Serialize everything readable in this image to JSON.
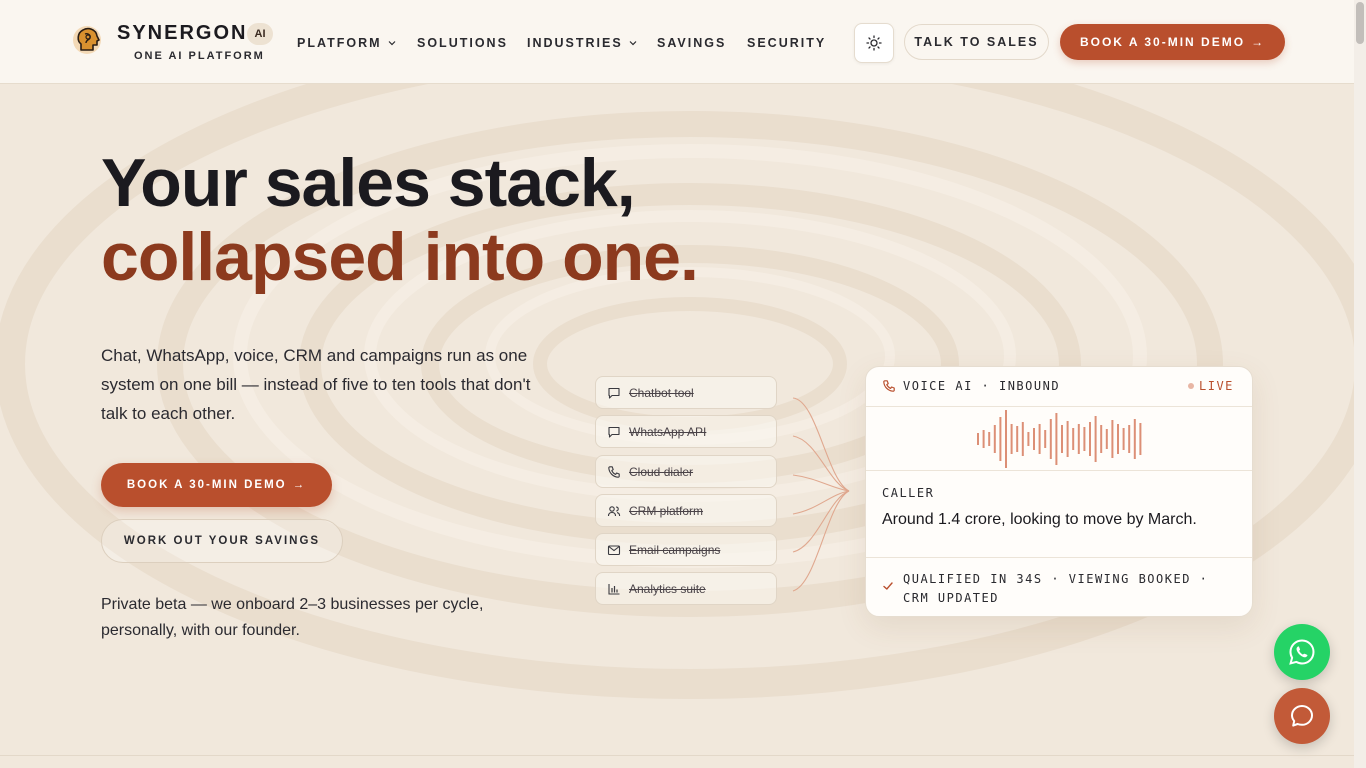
{
  "brand": {
    "name": "SYNERGON",
    "badge": "AI",
    "tagline": "ONE AI PLATFORM"
  },
  "nav": {
    "items": [
      {
        "label": "PLATFORM",
        "has_dropdown": true
      },
      {
        "label": "SOLUTIONS",
        "has_dropdown": false
      },
      {
        "label": "INDUSTRIES",
        "has_dropdown": true
      },
      {
        "label": "SAVINGS",
        "has_dropdown": false
      },
      {
        "label": "SECURITY",
        "has_dropdown": false
      }
    ],
    "theme_icon": "sun-icon",
    "talk_label": "TALK TO SALES",
    "demo_label": "BOOK A 30-MIN DEMO",
    "demo_arrow": "→"
  },
  "hero": {
    "headline": "Your sales stack,",
    "headline_accent": "collapsed into one.",
    "subheading": "Chat, WhatsApp, voice, CRM and campaigns run as one system on one bill — instead of five to ten tools that don't talk to each other.",
    "primary_cta": "BOOK A 30-MIN DEMO",
    "primary_cta_arrow": "→",
    "secondary_cta": "WORK OUT YOUR SAVINGS",
    "note": "Private beta — we onboard 2–3 businesses per cycle, personally, with our founder."
  },
  "tools": [
    {
      "label": "Chatbot tool",
      "icon": "chat-bubble-icon"
    },
    {
      "label": "WhatsApp API",
      "icon": "chat-bubble-icon"
    },
    {
      "label": "Cloud dialer",
      "icon": "phone-icon"
    },
    {
      "label": "CRM platform",
      "icon": "users-icon"
    },
    {
      "label": "Email campaigns",
      "icon": "mail-icon"
    },
    {
      "label": "Analytics suite",
      "icon": "bar-chart-icon"
    }
  ],
  "voice_card": {
    "title": "VOICE AI · INBOUND",
    "live_label": "LIVE",
    "caller_label": "CALLER",
    "quote": "Around 1.4 crore, looking to move by March.",
    "status": "QUALIFIED IN 34S · VIEWING BOOKED · CRM UPDATED"
  },
  "colors": {
    "accent": "#b94f2d",
    "accent_dark": "#8c3a1e",
    "background": "#f1e8dc",
    "header_bg": "#faf6f0",
    "whatsapp": "#25d366",
    "wave": "#dc8f76"
  },
  "floating": {
    "whatsapp_icon": "whatsapp-icon",
    "chat_icon": "chat-icon"
  }
}
